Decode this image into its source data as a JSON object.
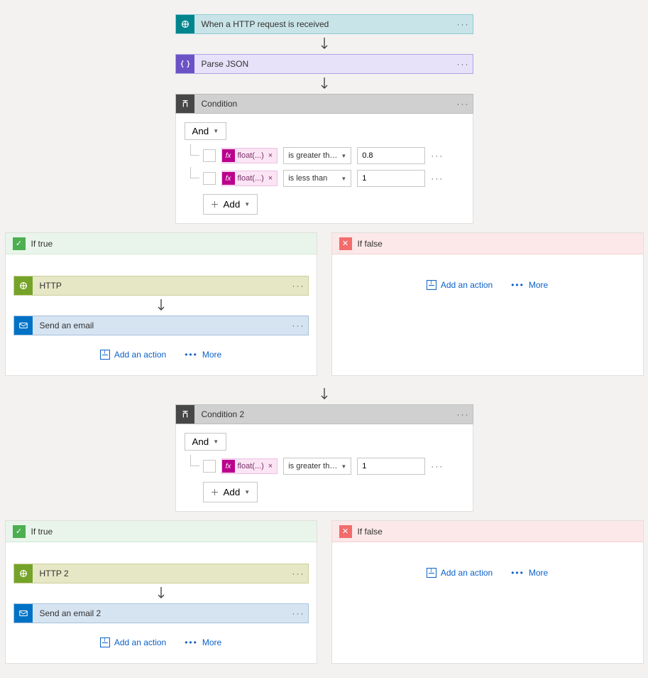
{
  "steps": {
    "trigger": {
      "title": "When a HTTP request is received"
    },
    "parse": {
      "title": "Parse JSON"
    },
    "cond1": {
      "title": "Condition",
      "and": "And",
      "rows": [
        {
          "fx": "float(...)",
          "op": "is greater than o...",
          "val": "0.8"
        },
        {
          "fx": "float(...)",
          "op": "is less than",
          "val": "1"
        }
      ],
      "add": "Add"
    },
    "cond2": {
      "title": "Condition 2",
      "and": "And",
      "rows": [
        {
          "fx": "float(...)",
          "op": "is greater than o...",
          "val": "1"
        }
      ],
      "add": "Add"
    }
  },
  "branches": {
    "true": "If true",
    "false": "If false",
    "http1": "HTTP",
    "email1": "Send an email",
    "http2": "HTTP 2",
    "email2": "Send an email 2"
  },
  "actions": {
    "add": "Add an action",
    "more": "More"
  },
  "icons": {
    "fx": "fx"
  }
}
